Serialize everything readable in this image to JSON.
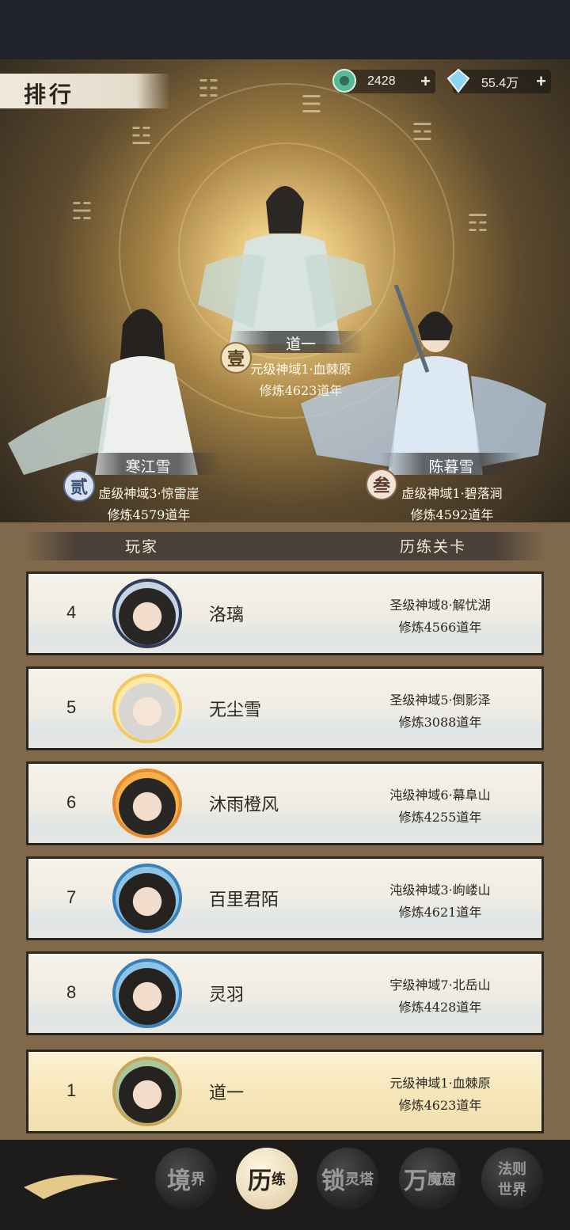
{
  "header": {
    "title": "排行",
    "resources": [
      {
        "icon": "jade-token-icon",
        "value": "2428",
        "plus": "+"
      },
      {
        "icon": "crystal-gem-icon",
        "value": "55.4万",
        "plus": "+"
      }
    ]
  },
  "podium": {
    "first": {
      "badge": "壹",
      "name": "道一",
      "stage": "元级神域1·血棘原",
      "years": "修炼4623道年"
    },
    "second": {
      "badge": "贰",
      "name": "寒江雪",
      "stage": "虚级神域3·惊雷崖",
      "years": "修炼4579道年"
    },
    "third": {
      "badge": "叁",
      "name": "陈暮雪",
      "stage": "虚级神域1·碧落涧",
      "years": "修炼4592道年"
    }
  },
  "columns": {
    "player": "玩家",
    "stage": "历练关卡"
  },
  "rows": [
    {
      "rank": "4",
      "name": "洛璃",
      "stage": "圣级神域8·解忧湖",
      "years": "修炼4566道年"
    },
    {
      "rank": "5",
      "name": "无尘雪",
      "stage": "圣级神域5·倒影泽",
      "years": "修炼3088道年"
    },
    {
      "rank": "6",
      "name": "沐雨橙风",
      "stage": "沌级神域6·幕阜山",
      "years": "修炼4255道年"
    },
    {
      "rank": "7",
      "name": "百里君陌",
      "stage": "沌级神域3·岣嵝山",
      "years": "修炼4621道年"
    },
    {
      "rank": "8",
      "name": "灵羽",
      "stage": "宇级神域7·北岳山",
      "years": "修炼4428道年"
    }
  ],
  "self_row": {
    "rank": "1",
    "name": "道一",
    "stage": "元级神域1·血棘原",
    "years": "修炼4623道年"
  },
  "nav": [
    {
      "big": "境",
      "small": "界"
    },
    {
      "big": "历",
      "small": "练"
    },
    {
      "big": "锁",
      "small": "灵",
      "small2": "塔"
    },
    {
      "big": "万",
      "small": "魔",
      "small2": "窟"
    },
    {
      "big": "法则",
      "small": "世界"
    }
  ]
}
